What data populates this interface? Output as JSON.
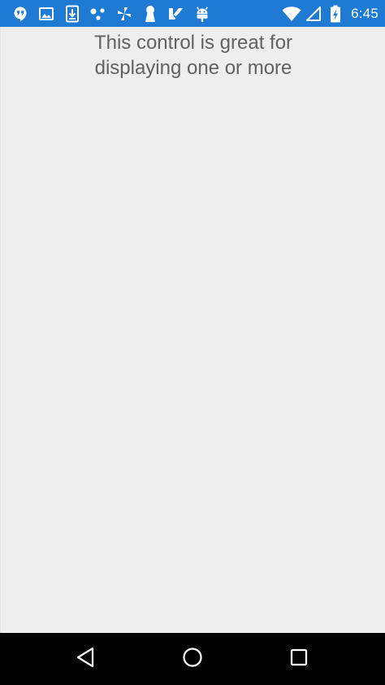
{
  "status_bar": {
    "background": "#1e7ad3",
    "left_icons": [
      "hangouts-icon",
      "gallery-icon",
      "download-icon",
      "connections-icon",
      "pinwheel-icon",
      "keyhole-icon",
      "checkmark-app-icon",
      "android-icon"
    ],
    "right_icons": [
      "wifi-icon",
      "cellular-signal-icon",
      "battery-charging-icon"
    ],
    "time": "6:45"
  },
  "content": {
    "background": "#eeeeee",
    "text_color": "#616161",
    "message_lines": [
      "This control is great for",
      "displaying one or more"
    ]
  },
  "nav_bar": {
    "buttons": [
      "back-icon",
      "home-icon",
      "recents-icon"
    ]
  }
}
